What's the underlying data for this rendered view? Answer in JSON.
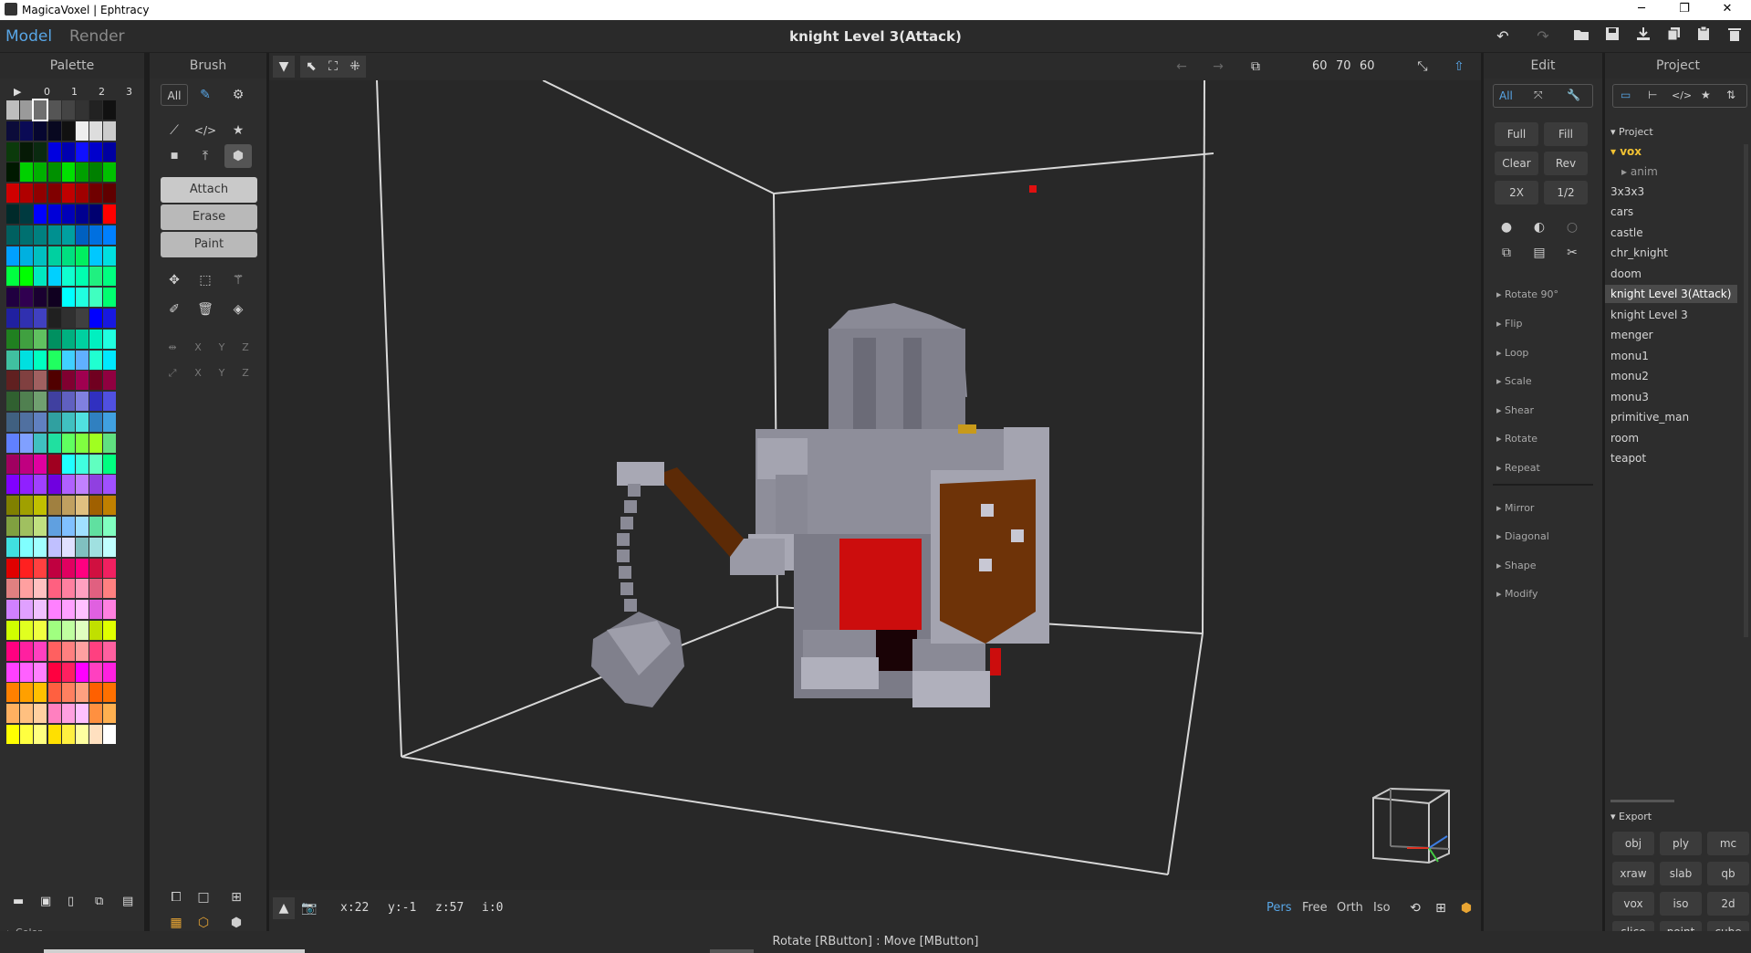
{
  "window": {
    "title": "MagicaVoxel | Ephtracy",
    "minimize": "─",
    "restore": "❐",
    "close": "✕"
  },
  "topbar": {
    "tab_model": "Model",
    "tab_render": "Render",
    "doc_title": "knight Level 3(Attack)"
  },
  "toolbar_icons": [
    "undo-icon",
    "redo-icon",
    "open-icon",
    "save-icon",
    "export-icon",
    "copy-icon",
    "paste-icon",
    "delete-icon"
  ],
  "palette": {
    "title": "Palette",
    "page_labels": [
      "▶",
      "0",
      "1",
      "2",
      "3"
    ],
    "color_section": "Color"
  },
  "brush": {
    "title": "Brush",
    "filter_all": "All",
    "modes": [
      "Attach",
      "Erase",
      "Paint"
    ],
    "axis_labels": [
      "X",
      "Y",
      "Z"
    ]
  },
  "viewport": {
    "size_x": "60",
    "size_y": "70",
    "size_z": "60"
  },
  "bottombar": {
    "x": "x:22",
    "y": "y:-1",
    "z": "z:57",
    "i": "i:0",
    "views": [
      "Pers",
      "Free",
      "Orth",
      "Iso"
    ],
    "active_view": "Pers"
  },
  "edit": {
    "title": "Edit",
    "filter_all": "All",
    "buttons": [
      [
        "Full",
        "Fill"
      ],
      [
        "Clear",
        "Rev"
      ],
      [
        "2X",
        "1/2"
      ]
    ],
    "sections_a": [
      "Rotate 90°",
      "Flip",
      "Loop",
      "Scale",
      "Shear",
      "Rotate",
      "Repeat"
    ],
    "sections_b": [
      "Mirror",
      "Diagonal",
      "Shape",
      "Modify"
    ]
  },
  "project": {
    "title": "Project",
    "section": "Project",
    "folder": "vox",
    "subfolder": "anim",
    "items": [
      "3x3x3",
      "cars",
      "castle",
      "chr_knight",
      "doom",
      "knight Level 3(Attack)",
      "knight Level 3",
      "menger",
      "monu1",
      "monu2",
      "monu3",
      "primitive_man",
      "room",
      "teapot"
    ],
    "selected": "knight Level 3(Attack)",
    "export_title": "Export",
    "export_buttons": [
      "obj",
      "ply",
      "mc",
      "xraw",
      "slab",
      "qb",
      "vox",
      "iso",
      "2d",
      "slice",
      "point",
      "cube"
    ]
  },
  "status": "Rotate [RButton] : Move [MButton]",
  "colors": {
    "accent": "#58a6e6",
    "panel": "#2d2d2d",
    "viewport": "#282828"
  }
}
